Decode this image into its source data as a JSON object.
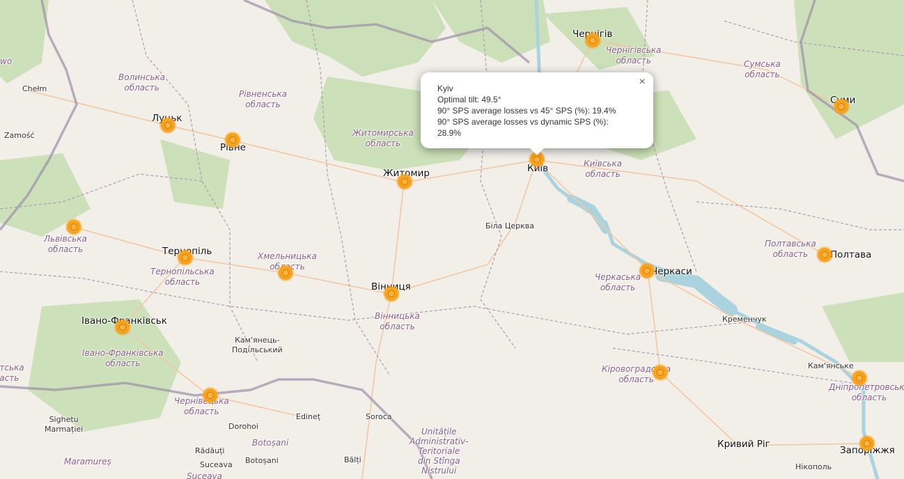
{
  "map": {
    "colors": {
      "land": "#f2efe9",
      "forest": "#b7d5a4",
      "water": "#aad3df",
      "boundary": "#9e8fa6",
      "road": "#f3c7a0",
      "marker": "#f7a21b"
    },
    "cities": {
      "chernihiv": "Чернігів",
      "lutsk": "Луцьк",
      "rivne": "Рівне",
      "zhytomyr": "Житомир",
      "kyiv": "Київ",
      "sumy": "Суми",
      "ternopil": "Тернопіль",
      "vinnytsia": "Вінниця",
      "cherkasy": "Черкаси",
      "poltava": "Полтава",
      "ivano": "Івано-Франківськ",
      "kremenchuk": "Кременчук",
      "kamianske": "Кам'янське",
      "kryvyi": "Кривий Ріг",
      "zaporizhzhia": "Запоріжжя",
      "bila": "Біла Церква",
      "kamianets": "Кам'янець-\nПодільський",
      "chelm": "Chełm",
      "zamosc": "Zamość",
      "sighetu": "Sighetu\nMarmației",
      "dorohoi": "Dorohoi",
      "edinet": "Edineț",
      "soroca": "Soroca",
      "balti": "Bălți",
      "radauti": "Rădăuți",
      "suceava": "Suceava",
      "botosani": "Botoșani",
      "nikopol": "Нікополь"
    },
    "regions": {
      "volyn": "Волинська\nобласть",
      "rivne": "Рівненська\nобласть",
      "zhytomyr": "Житомирська\nобласть",
      "chernihiv": "Чернігівська\nобласть",
      "sumy": "Сумська\nобласть",
      "kyiv": "Київська\nобласть",
      "lviv": "Львівська\nобласть",
      "khmelnytskyi": "Хмельницька\nобласть",
      "ternopil": "Тернопільська\nобласть",
      "vinnytsia": "Вінницька\nобласть",
      "cherkasy": "Черкаська\nобласть",
      "poltava": "Полтавська\nобласть",
      "ivano": "Івано-Франківська\nобласть",
      "chernivtsi": "Чернівецька\nобласть",
      "kirovohrad": "Кіровоградська\nобласть",
      "dnipro": "Дніпропетровська\nобласть",
      "botosani": "Botoșani",
      "maramures": "Maramureș",
      "suceava": "Suceava",
      "moldova": "Unitățile\nAdministrativ-\nTeritoriale\ndin Stînga\nNistrului",
      "zakarp": "атська\nасть",
      "wo": "wo"
    }
  },
  "popup": {
    "city": "Kyiv",
    "line1": "Optimal tilt: 49.5°",
    "line2": "90° SPS average losses vs 45° SPS (%): 19.4%",
    "line3": "90° SPS average losses vs dynamic SPS (%): 28.9%",
    "close": "×"
  }
}
